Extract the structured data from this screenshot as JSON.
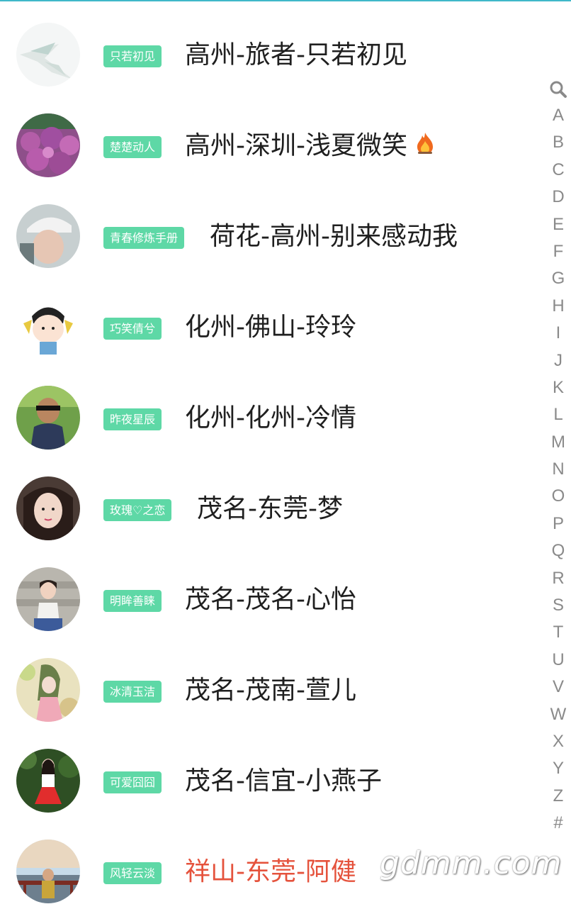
{
  "contacts": [
    {
      "tag": "只若初见",
      "name": "高州-旅者-只若初见"
    },
    {
      "tag": "楚楚动人",
      "name": "高州-深圳-浅夏微笑"
    },
    {
      "tag": "青春修炼手册",
      "name": "荷花-高州-别来感动我"
    },
    {
      "tag": "巧笑倩兮",
      "name": "化州-佛山-玲玲"
    },
    {
      "tag": "昨夜星辰",
      "name": "化州-化州-冷情"
    },
    {
      "tag": "玫瑰♡之恋",
      "name": "茂名-东莞-梦"
    },
    {
      "tag": "明眸善睐",
      "name": "茂名-茂名-心怡"
    },
    {
      "tag": "冰清玉洁",
      "name": "茂名-茂南-萱儿"
    },
    {
      "tag": "可爱囧囧",
      "name": "茂名-信宜-小燕子"
    },
    {
      "tag": "风轻云淡",
      "name": "祥山-东莞-阿健"
    }
  ],
  "index_bar": {
    "search_icon": "search-icon",
    "letters": [
      "A",
      "B",
      "C",
      "D",
      "E",
      "F",
      "G",
      "H",
      "I",
      "J",
      "K",
      "L",
      "M",
      "N",
      "O",
      "P",
      "Q",
      "R",
      "S",
      "T",
      "U",
      "V",
      "W",
      "X",
      "Y",
      "Z",
      "#"
    ]
  },
  "watermark": "gdmm.com",
  "colors": {
    "accent": "#3fb8c9",
    "tag_bg": "#5ed8a6",
    "name_text": "#1f1f1f",
    "highlight_name": "#e5533d",
    "index_text": "#8a8a8a"
  }
}
